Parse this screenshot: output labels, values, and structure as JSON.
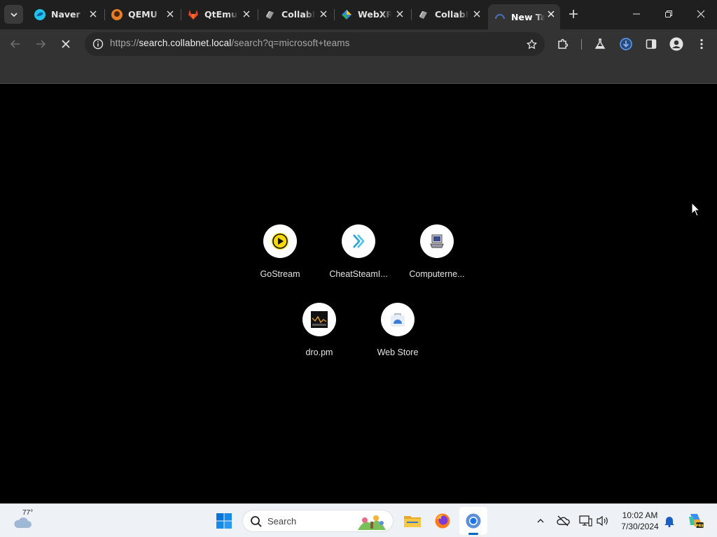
{
  "browser": {
    "tabs": [
      {
        "title": "Naver Whale",
        "icon": "naver-whale-icon"
      },
      {
        "title": "QEMU",
        "icon": "qemu-icon"
      },
      {
        "title": "QtEmu",
        "icon": "gitlab-icon"
      },
      {
        "title": "CollabNet",
        "icon": "collabnet-icon"
      },
      {
        "title": "WebXR",
        "icon": "webxr-icon"
      },
      {
        "title": "CollabNet",
        "icon": "collabnet-icon"
      },
      {
        "title": "New Tab",
        "icon": "loading-icon"
      }
    ],
    "active_tab": 6,
    "address": {
      "prefix": "https://",
      "host": "search.collabnet.local",
      "path": "/search?q=microsoft+teams"
    }
  },
  "shortcuts": [
    {
      "label": "GoStream",
      "icon": "play-icon"
    },
    {
      "label": "CheatSteamI...",
      "icon": "double-chevron-icon"
    },
    {
      "label": "Computerne...",
      "icon": "computer-icon"
    },
    {
      "label": "dro.pm",
      "icon": "chart-thumbnail-icon"
    },
    {
      "label": "Web Store",
      "icon": "web-store-icon"
    }
  ],
  "taskbar": {
    "weather_temp": "77°",
    "search_placeholder": "Search",
    "time": "10:02 AM",
    "date": "7/30/2024"
  },
  "colors": {
    "tabstrip": "#1f1f1f",
    "toolbar": "#333333",
    "page_background": "#000000",
    "taskbar": "#eef1f6",
    "accent": "#0067c0"
  }
}
